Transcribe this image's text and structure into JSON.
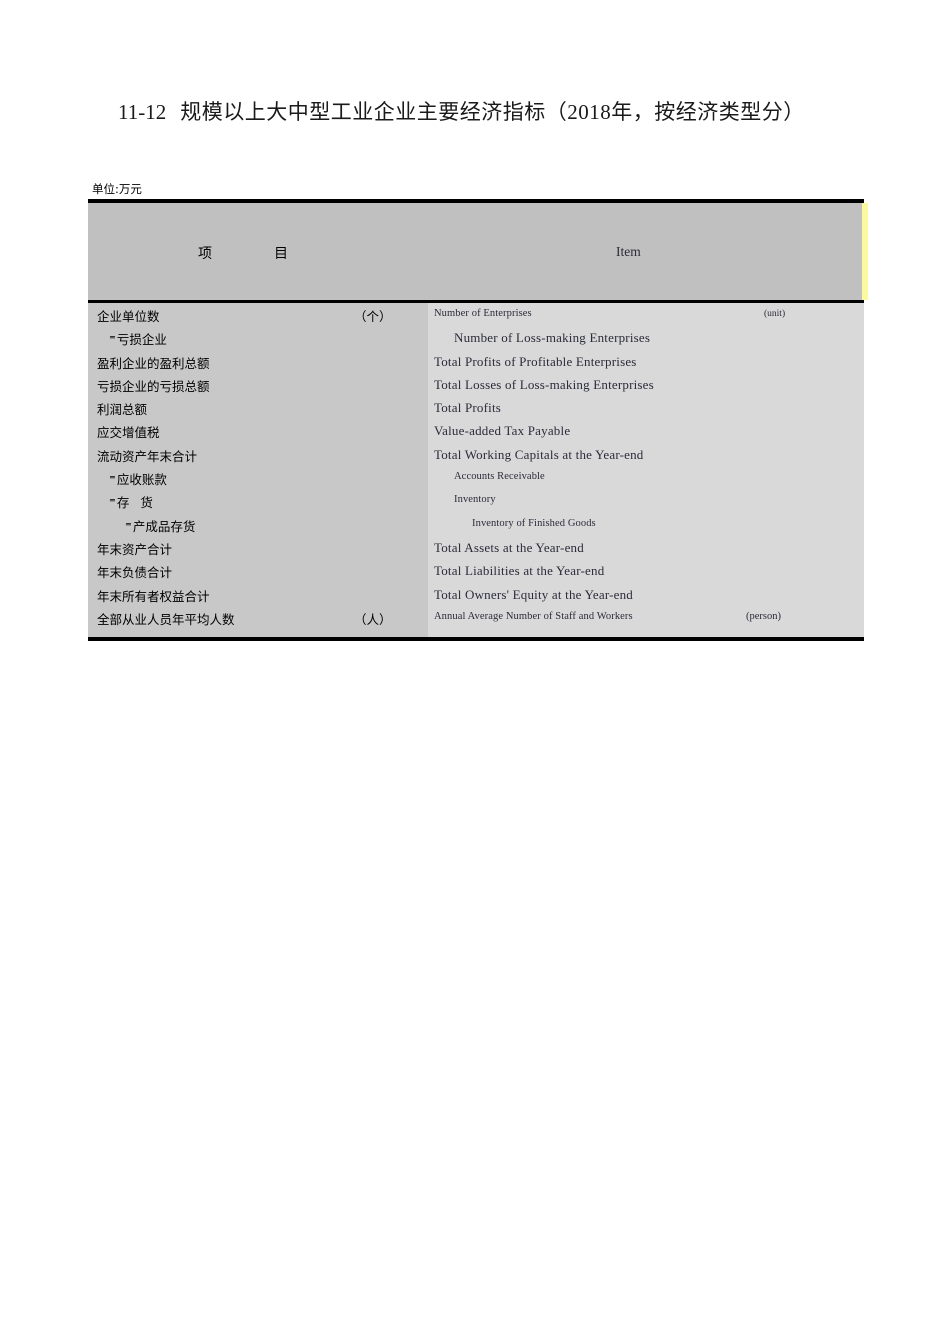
{
  "title": {
    "number": "11-12",
    "text_cn": "规模以上大中型工业企业主要经济指标（2018年，按经济类型分）"
  },
  "unit_caption": "单位:万元",
  "table": {
    "header": {
      "col_cn_left": "项",
      "col_cn_right": "目",
      "col_en": "Item"
    },
    "rows": [
      {
        "cn": "企业单位数",
        "cn_unit": "（个）",
        "en": "Number of Enterprises",
        "en_unit": "(unit)",
        "indent": 0,
        "marker": false,
        "small_en": true
      },
      {
        "cn": "亏损企业",
        "cn_unit": "",
        "en": "Number of Loss-making Enterprises",
        "en_unit": "",
        "indent": 1,
        "marker": true,
        "small_en": false
      },
      {
        "cn": "盈利企业的盈利总额",
        "cn_unit": "",
        "en": "Total Profits of Profitable Enterprises",
        "en_unit": "",
        "indent": 0,
        "marker": false,
        "small_en": false
      },
      {
        "cn": "亏损企业的亏损总额",
        "cn_unit": "",
        "en": "Total Losses of Loss-making Enterprises",
        "en_unit": "",
        "indent": 0,
        "marker": false,
        "small_en": false
      },
      {
        "cn": "利润总额",
        "cn_unit": "",
        "en": "Total Profits",
        "en_unit": "",
        "indent": 0,
        "marker": false,
        "small_en": false
      },
      {
        "cn": "应交增值税",
        "cn_unit": "",
        "en": "Value-added Tax Payable",
        "en_unit": "",
        "indent": 0,
        "marker": false,
        "small_en": false
      },
      {
        "cn": "流动资产年末合计",
        "cn_unit": "",
        "en": "Total Working Capitals at the Year-end",
        "en_unit": "",
        "indent": 0,
        "marker": false,
        "small_en": false
      },
      {
        "cn": "应收账款",
        "cn_unit": "",
        "en": "Accounts Receivable",
        "en_unit": "",
        "indent": 1,
        "marker": true,
        "small_en": true
      },
      {
        "cn": "存 货",
        "cn_unit": "",
        "en": "Inventory",
        "en_unit": "",
        "indent": 1,
        "marker": true,
        "small_en": true
      },
      {
        "cn": "产成品存货",
        "cn_unit": "",
        "en": "Inventory of Finished Goods",
        "en_unit": "",
        "indent": 2,
        "marker": true,
        "small_en": true
      },
      {
        "cn": "年末资产合计",
        "cn_unit": "",
        "en": "Total Assets at the Year-end",
        "en_unit": "",
        "indent": 0,
        "marker": false,
        "small_en": false
      },
      {
        "cn": "年末负债合计",
        "cn_unit": "",
        "en": "Total Liabilities at the Year-end",
        "en_unit": "",
        "indent": 0,
        "marker": false,
        "small_en": false
      },
      {
        "cn": "年末所有者权益合计",
        "cn_unit": "",
        "en": "Total Owners' Equity at the Year-end",
        "en_unit": "",
        "indent": 0,
        "marker": false,
        "small_en": false
      },
      {
        "cn": "全部从业人员年平均人数",
        "cn_unit": "（人）",
        "en": "Annual Average Number of Staff and Workers",
        "en_unit": "(person)",
        "indent": 0,
        "marker": false,
        "small_en": true
      }
    ]
  },
  "colors": {
    "header_bg": "#c0c0c0",
    "body_left_bg": "#c8c8c8",
    "body_right_bg": "#d9d9d9",
    "rule": "#000000",
    "highlight_edge": "#fbfaa0",
    "text_cn": "#000000",
    "text_en": "#2b2b3a"
  }
}
